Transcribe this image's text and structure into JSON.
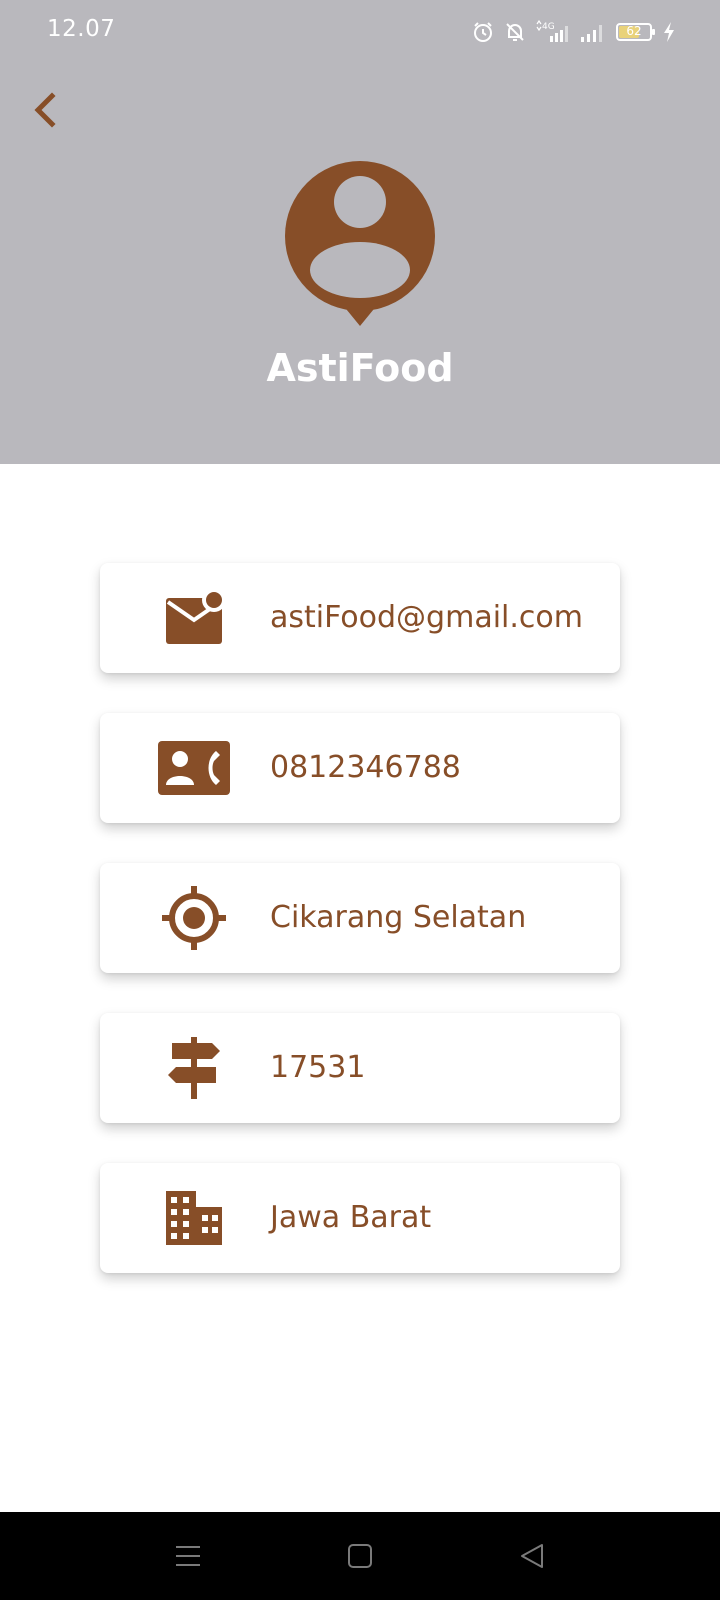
{
  "status_bar": {
    "time": "12.07",
    "battery_level": "62",
    "icons": [
      "alarm-icon",
      "bell-off-icon",
      "signal-4g-icon",
      "signal-icon",
      "battery-icon",
      "charging-icon"
    ]
  },
  "header": {
    "back_icon": "chevron-left-icon",
    "avatar_icon": "user-pin-icon",
    "store_name": "AstiFood"
  },
  "colors": {
    "header_bg": "#b9b8bd",
    "accent_brown": "#874e28",
    "nav_bg": "#000000"
  },
  "info": [
    {
      "icon": "email-notification-icon",
      "text": "astiFood@gmail.com"
    },
    {
      "icon": "contact-phone-icon",
      "text": "0812346788"
    },
    {
      "icon": "location-target-icon",
      "text": "Cikarang Selatan"
    },
    {
      "icon": "signpost-icon",
      "text": "17531"
    },
    {
      "icon": "building-icon",
      "text": "Jawa Barat"
    }
  ],
  "nav_bar": {
    "buttons": [
      "menu-icon",
      "home-square-icon",
      "back-triangle-icon"
    ]
  }
}
